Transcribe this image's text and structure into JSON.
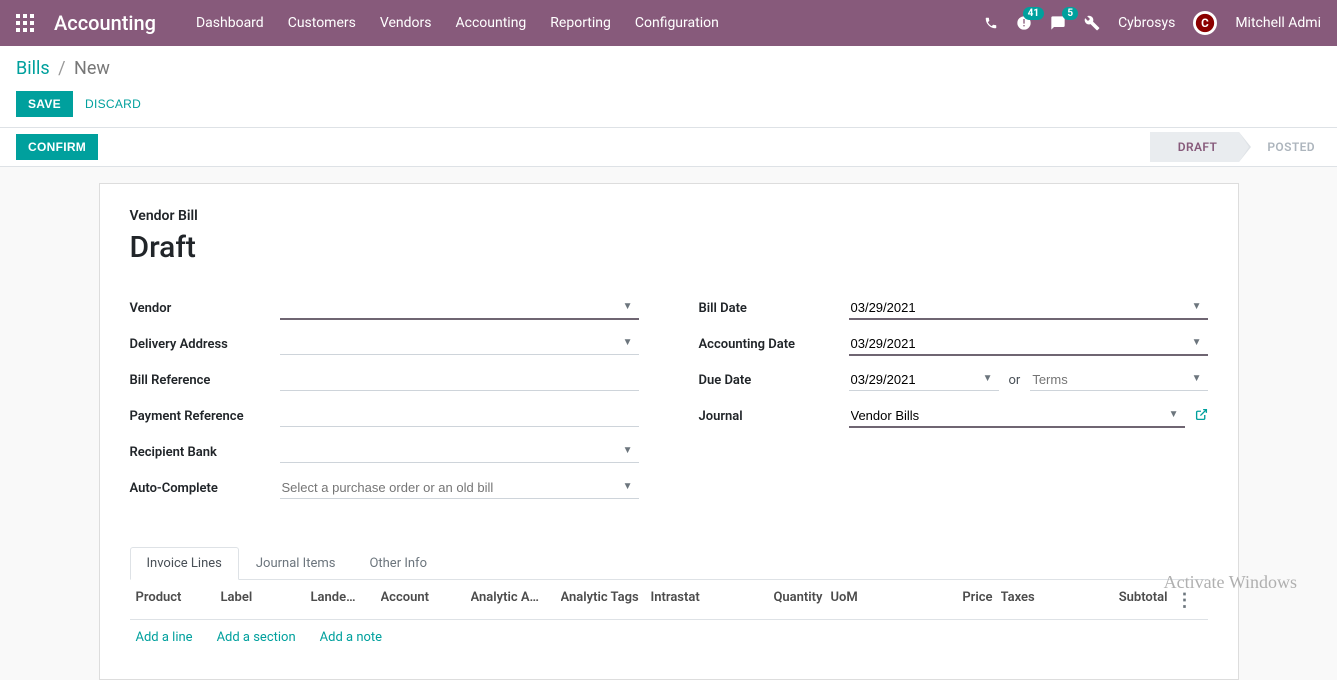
{
  "nav": {
    "brand": "Accounting",
    "menu": [
      "Dashboard",
      "Customers",
      "Vendors",
      "Accounting",
      "Reporting",
      "Configuration"
    ],
    "clock_badge": "41",
    "chat_badge": "5",
    "company": "Cybrosys",
    "user": "Mitchell Admi"
  },
  "breadcrumb": {
    "root": "Bills",
    "current": "New"
  },
  "buttons": {
    "save": "SAVE",
    "discard": "DISCARD",
    "confirm": "CONFIRM"
  },
  "status": {
    "draft": "DRAFT",
    "posted": "POSTED"
  },
  "title": {
    "small": "Vendor Bill",
    "big": "Draft"
  },
  "fields_left": {
    "vendor": {
      "label": "Vendor",
      "value": ""
    },
    "delivery": {
      "label": "Delivery Address",
      "value": ""
    },
    "billref": {
      "label": "Bill Reference",
      "value": ""
    },
    "payref": {
      "label": "Payment Reference",
      "value": ""
    },
    "bank": {
      "label": "Recipient Bank",
      "value": ""
    },
    "auto": {
      "label": "Auto-Complete",
      "placeholder": "Select a purchase order or an old bill"
    }
  },
  "fields_right": {
    "billdate": {
      "label": "Bill Date",
      "value": "03/29/2021"
    },
    "accdate": {
      "label": "Accounting Date",
      "value": "03/29/2021"
    },
    "duedate": {
      "label": "Due Date",
      "value": "03/29/2021",
      "or": "or",
      "terms_placeholder": "Terms"
    },
    "journal": {
      "label": "Journal",
      "value": "Vendor Bills"
    }
  },
  "tabs": [
    "Invoice Lines",
    "Journal Items",
    "Other Info"
  ],
  "columns": [
    "Product",
    "Label",
    "Lande…",
    "Account",
    "Analytic A…",
    "Analytic Tags",
    "Intrastat",
    "Quantity",
    "UoM",
    "Price",
    "Taxes",
    "Subtotal"
  ],
  "line_actions": {
    "add_line": "Add a line",
    "add_section": "Add a section",
    "add_note": "Add a note"
  },
  "watermark": "Activate Windows"
}
